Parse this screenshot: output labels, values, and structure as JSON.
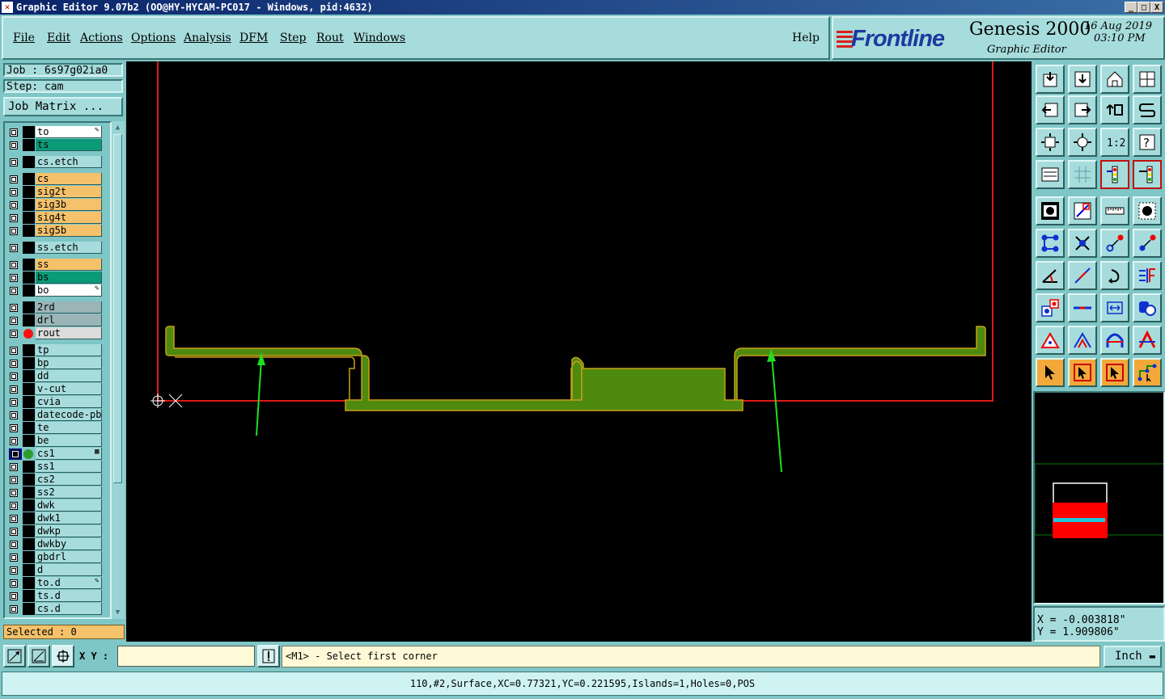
{
  "window": {
    "title": "Graphic Editor 9.07b2 (OO@HY-HYCAM-PC017 - Windows, pid:4632)",
    "buttons": [
      "_",
      "□",
      "X"
    ]
  },
  "menu": {
    "items": [
      "File",
      "Edit",
      "Actions",
      "Options",
      "Analysis",
      "DFM",
      "Step",
      "Rout",
      "Windows"
    ],
    "help": "Help"
  },
  "logo": {
    "brand": "Frontline",
    "product": "Genesis 2000",
    "subtitle": "Graphic Editor",
    "date": "16 Aug 2019",
    "time": "03:10 PM"
  },
  "job": {
    "job_label": "Job : 6s97g02ia0",
    "step_label": "Step: cam",
    "matrix_button": "Job Matrix ..."
  },
  "layers": [
    {
      "name": "to",
      "color": "#ffffff",
      "mark": "✎"
    },
    {
      "name": "ts",
      "color": "#0a9a78"
    },
    {
      "gap": true
    },
    {
      "name": "cs.etch",
      "color": "#a7dcdc"
    },
    {
      "gap": true
    },
    {
      "name": "cs",
      "color": "#f5c26b"
    },
    {
      "name": "sig2t",
      "color": "#f5c26b"
    },
    {
      "name": "sig3b",
      "color": "#f5c26b"
    },
    {
      "name": "sig4t",
      "color": "#f5c26b"
    },
    {
      "name": "sig5b",
      "color": "#f5c26b"
    },
    {
      "gap": true
    },
    {
      "name": "ss.etch",
      "color": "#a7dcdc"
    },
    {
      "gap": true
    },
    {
      "name": "ss",
      "color": "#f5c26b"
    },
    {
      "name": "bs",
      "color": "#0a9a78"
    },
    {
      "name": "bo",
      "color": "#ffffff",
      "mark": "✎"
    },
    {
      "gap": true
    },
    {
      "name": "2rd",
      "color": "#9ab4b8"
    },
    {
      "name": "drl",
      "color": "#9ab4b8"
    },
    {
      "name": "rout",
      "color": "#dcdcdc",
      "dot": "#ff1010"
    },
    {
      "gap": true
    },
    {
      "name": "tp",
      "color": "#a7dcdc"
    },
    {
      "name": "bp",
      "color": "#a7dcdc"
    },
    {
      "name": "dd",
      "color": "#a7dcdc"
    },
    {
      "name": "v-cut",
      "color": "#a7dcdc"
    },
    {
      "name": "cvia",
      "color": "#a7dcdc"
    },
    {
      "name": "datecode-pbo",
      "color": "#a7dcdc"
    },
    {
      "name": "te",
      "color": "#a7dcdc"
    },
    {
      "name": "be",
      "color": "#a7dcdc"
    },
    {
      "name": "cs1",
      "color": "#a7dcdc",
      "dot": "#2e9a2e",
      "active": true,
      "mark": "▦"
    },
    {
      "name": "ss1",
      "color": "#a7dcdc"
    },
    {
      "name": "cs2",
      "color": "#a7dcdc"
    },
    {
      "name": "ss2",
      "color": "#a7dcdc"
    },
    {
      "name": "dwk",
      "color": "#a7dcdc"
    },
    {
      "name": "dwk1",
      "color": "#a7dcdc"
    },
    {
      "name": "dwkp",
      "color": "#a7dcdc"
    },
    {
      "name": "dwkby",
      "color": "#a7dcdc"
    },
    {
      "name": "gbdrl",
      "color": "#a7dcdc"
    },
    {
      "name": "d",
      "color": "#a7dcdc"
    },
    {
      "name": "to.d",
      "color": "#a7dcdc",
      "mark": "✎"
    },
    {
      "name": "ts.d",
      "color": "#a7dcdc"
    },
    {
      "name": "cs.d",
      "color": "#a7dcdc"
    }
  ],
  "selected": "Selected : 0",
  "toolbar": {
    "icons": [
      "open-step-icon",
      "save-icon",
      "home-icon",
      "window-split-icon",
      "prev-step-icon",
      "next-step-icon",
      "undo-icon",
      "redo-icon",
      "zoom-fit-icon",
      "zoom-center-icon",
      "scale-1to2-icon",
      "help-query-icon",
      "display-settings-icon",
      "grid-icon",
      "layer-colors-icon",
      "layer-colors-alt-icon",
      "add-pad-icon",
      "add-line-icon",
      "measure-ruler-icon",
      "add-surface-icon",
      "net-icon",
      "delete-icon",
      "move-icon",
      "copy-icon",
      "angle-icon",
      "line-edit-icon",
      "arc-icon",
      "mirror-icon",
      "snap-icon",
      "cut-line-icon",
      "resize-icon",
      "shape-icon",
      "triangle-icon",
      "triangle-alt-icon",
      "feature-icon",
      "feature-alt-icon",
      "select-arrow-icon",
      "select-box-icon",
      "select-touch-icon",
      "select-net-icon"
    ],
    "zoom_label": "1:2"
  },
  "coords": {
    "x": "X = -0.003818\"",
    "y": "Y = 1.909806\""
  },
  "bottom": {
    "xy_label": "X Y :",
    "xy_value": "",
    "prompt": "<M1> - Select first corner",
    "units": "Inch",
    "status": "110,#2,Surface,XC=0.77321,YC=0.221595,Islands=1,Holes=0,POS"
  },
  "colors": {
    "background": "#7fc6c6",
    "panel": "#a7dcdc",
    "canvas": "#000000",
    "surface_fill": "#4e8a0e",
    "surface_outline": "#c8a018",
    "profile": "#e01818",
    "annotation_arrow": "#22dd22"
  }
}
